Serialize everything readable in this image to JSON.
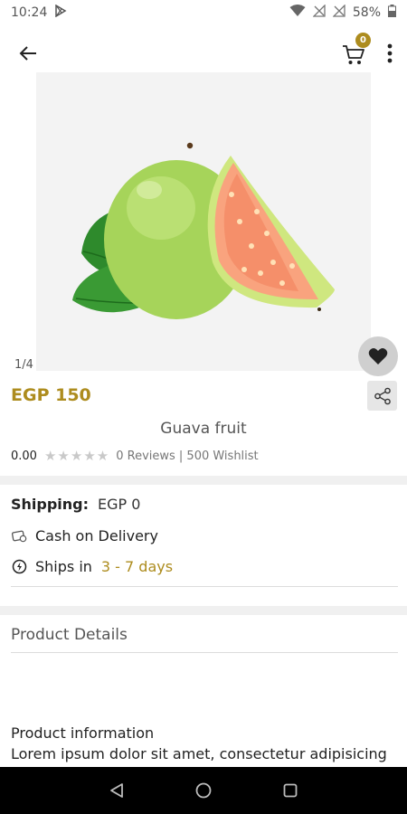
{
  "status_bar": {
    "time": "10:24",
    "battery": "58%"
  },
  "app_bar": {
    "cart_count": "0"
  },
  "gallery": {
    "counter": "1/4"
  },
  "product": {
    "price": "EGP 150",
    "name": "Guava fruit",
    "rating": "0.00",
    "reviews_wishlist": "0 Reviews | 500 Wishlist"
  },
  "shipping": {
    "label": "Shipping:",
    "value": "EGP 0",
    "cod": "Cash on Delivery",
    "ships_in_label": "Ships in",
    "ships_in_days": "3 - 7 days"
  },
  "details": {
    "section_title": "Product Details",
    "info_title": "Product information",
    "info_body": "Lorem ipsum dolor sit amet, consectetur adipisicing"
  },
  "colors": {
    "accent": "#ad8c1e"
  },
  "icons": [
    "play-store-icon",
    "wifi-icon",
    "signal-icon",
    "battery-icon",
    "back-arrow-icon",
    "cart-icon",
    "more-vert-icon",
    "heart-icon",
    "share-icon",
    "star-icon",
    "cash-icon",
    "clock-icon",
    "nav-back-icon",
    "nav-home-icon",
    "nav-recents-icon"
  ]
}
